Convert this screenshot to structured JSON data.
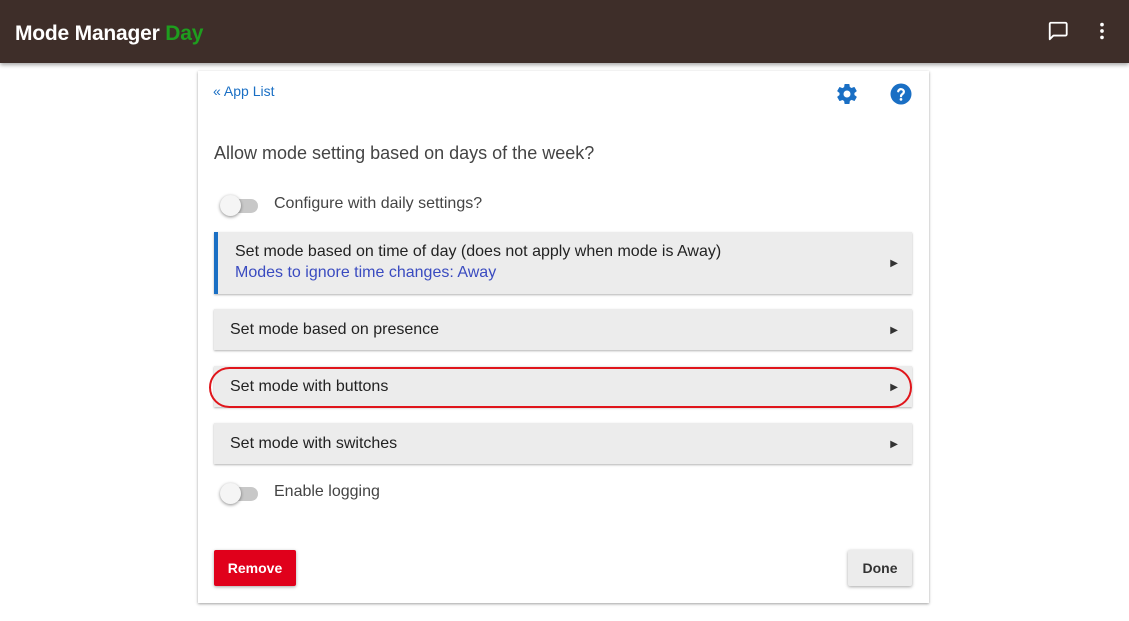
{
  "header": {
    "title": "Mode Manager",
    "mode": "Day",
    "mode_color": "#1e9e1e",
    "background_color": "#3e2e29",
    "icons": [
      "chat-icon",
      "more-vert-icon"
    ]
  },
  "card": {
    "back_link": "« App List",
    "icons": [
      "gear-icon",
      "help-icon"
    ],
    "accent_color": "#1a6fc4",
    "section_title": "Allow mode setting based on days of the week?",
    "daily_toggle": {
      "label": "Configure with daily settings?",
      "checked": false
    },
    "nav_items": [
      {
        "title": "Set mode based on time of day (does not apply when mode is Away)",
        "subtitle": "Modes to ignore time changes: Away",
        "active": true
      },
      {
        "title": "Set mode based on presence",
        "active": false
      },
      {
        "title": "Set mode with buttons",
        "active": false,
        "highlighted": true
      },
      {
        "title": "Set mode with switches",
        "active": false
      }
    ],
    "logging_toggle": {
      "label": "Enable logging",
      "checked": false
    },
    "buttons": {
      "remove": "Remove",
      "done": "Done",
      "remove_color": "#e0001b"
    },
    "highlight_color": "#e0151b"
  }
}
